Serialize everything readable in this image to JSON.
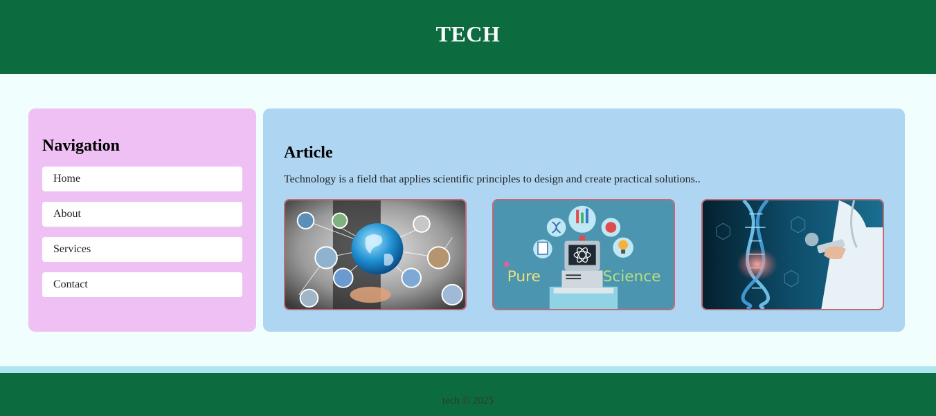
{
  "header": {
    "title": "TECH"
  },
  "nav": {
    "heading": "Navigation",
    "items": [
      {
        "label": "Home"
      },
      {
        "label": "About"
      },
      {
        "label": "Services"
      },
      {
        "label": "Contact"
      }
    ]
  },
  "article": {
    "heading": "Article",
    "text": "Technology is a field that applies scientific principles to design and create practical solutions..",
    "images": [
      {
        "icon": "globe-network-image"
      },
      {
        "icon": "pure-science-image",
        "caption_left": "Pure",
        "caption_right": "Science"
      },
      {
        "icon": "dna-doctor-image"
      }
    ]
  },
  "footer": {
    "text": "tech © 2025"
  },
  "colors": {
    "header_bg": "#0d6b40",
    "page_bg": "#f0fffe",
    "nav_bg": "#eec0f4",
    "article_bg": "#aed5f2",
    "image_border": "#c26a74"
  }
}
